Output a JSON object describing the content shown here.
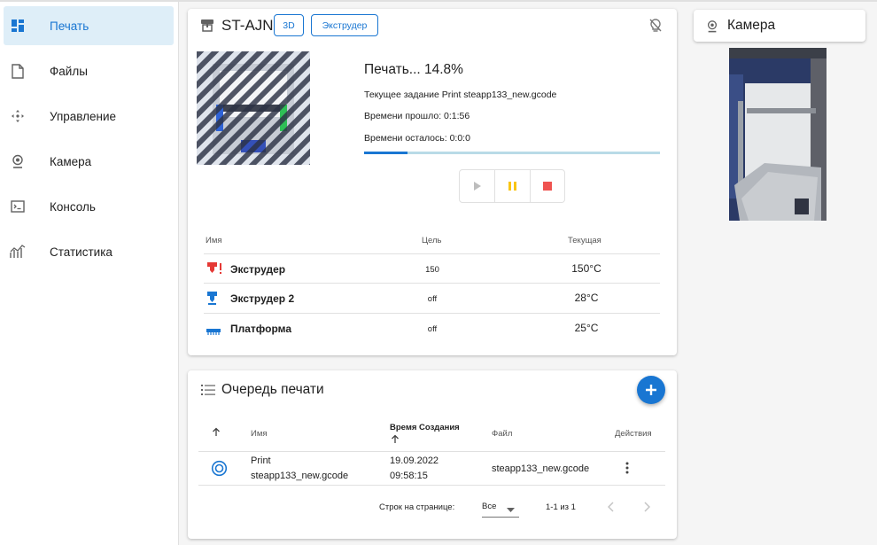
{
  "sidebar": {
    "items": [
      {
        "label": "Печать",
        "icon": "dashboard-icon",
        "active": true
      },
      {
        "label": "Файлы",
        "icon": "file-icon"
      },
      {
        "label": "Управление",
        "icon": "move-arrows-icon"
      },
      {
        "label": "Камера",
        "icon": "webcam-icon"
      },
      {
        "label": "Консоль",
        "icon": "console-icon"
      },
      {
        "label": "Статистика",
        "icon": "chart-icon"
      }
    ]
  },
  "printer": {
    "name": "ST-AJN",
    "chips": {
      "mode": "3D",
      "extruder": "Экструдер"
    },
    "status": "Печать... 14.8%",
    "progress": 0.148,
    "current_job": "Текущее задание Print steapp133_new.gcode",
    "elapsed": "Времени прошло: 0:1:56",
    "remaining": "Времени осталось: 0:0:0"
  },
  "temps": {
    "headers": {
      "name": "Имя",
      "target": "Цель",
      "current": "Текущая"
    },
    "rows": [
      {
        "name": "Экструдер",
        "target": "150",
        "current": "150°C",
        "icon": "extruder-alert-icon"
      },
      {
        "name": "Экструдер 2",
        "target": "off",
        "current": "28°C",
        "icon": "extruder-icon"
      },
      {
        "name": "Платформа",
        "target": "off",
        "current": "25°C",
        "icon": "bed-icon"
      }
    ]
  },
  "queue": {
    "title": "Очередь печати",
    "headers": {
      "name": "Имя",
      "created": "Время Создания",
      "file": "Файл",
      "actions": "Действия"
    },
    "rows": [
      {
        "name_line1": "Print",
        "name_line2": "steapp133_new.gcode",
        "date": "19.09.2022",
        "time": "09:58:15",
        "file": "steapp133_new.gcode"
      }
    ],
    "footer": {
      "rows_label": "Строк на странице:",
      "rows_value": "Все",
      "range": "1-1 из 1"
    }
  },
  "camera": {
    "title": "Камера"
  },
  "colors": {
    "accent": "#1976d2",
    "pause": "#f9c513",
    "stop": "#ef5350",
    "alert": "#e53935"
  }
}
